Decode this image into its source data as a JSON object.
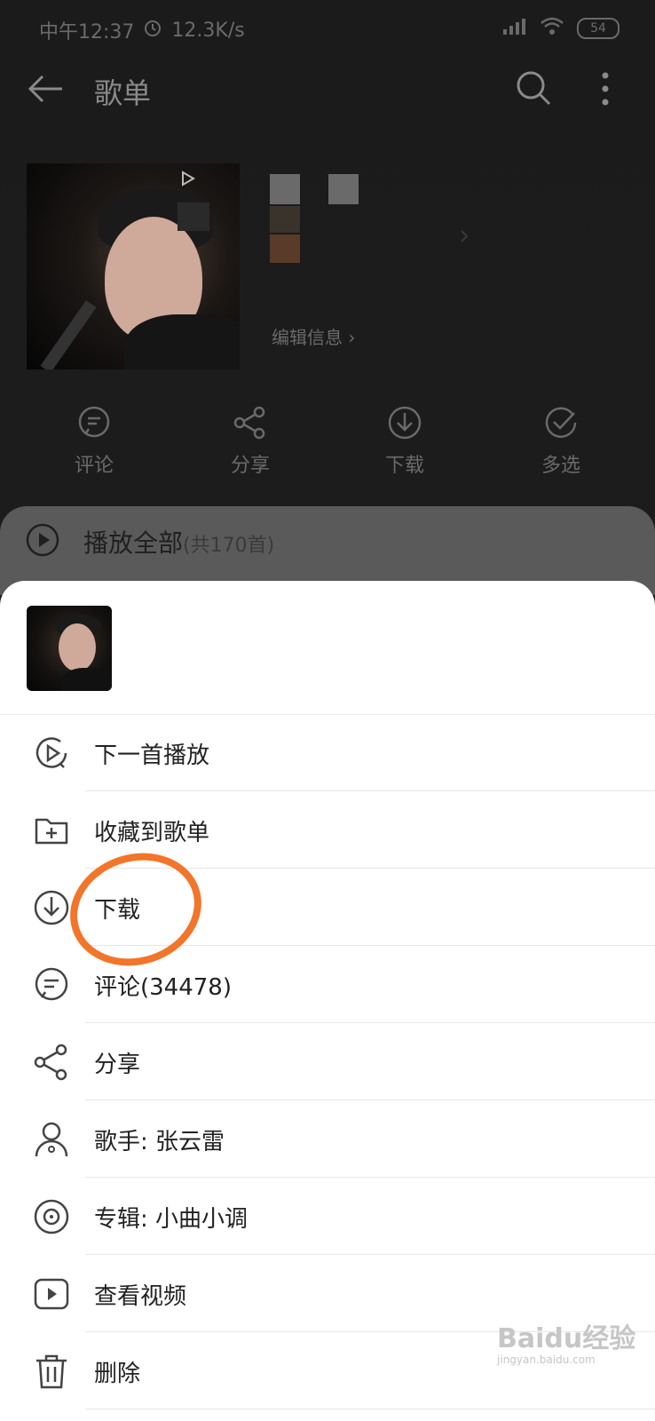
{
  "status_bar": {
    "time": "中午12:37",
    "speed": "12.3K/s",
    "battery": "54"
  },
  "header": {
    "title": "歌单"
  },
  "playlist": {
    "edit_info": "编辑信息 ›"
  },
  "actions": [
    {
      "label": "评论",
      "icon": "comment-icon"
    },
    {
      "label": "分享",
      "icon": "share-icon"
    },
    {
      "label": "下载",
      "icon": "download-icon"
    },
    {
      "label": "多选",
      "icon": "multiselect-icon"
    }
  ],
  "play_all": {
    "label": "播放全部",
    "count": "(共170首)"
  },
  "sheet": {
    "menu": [
      {
        "label": "下一首播放",
        "icon": "play-next-icon"
      },
      {
        "label": "收藏到歌单",
        "icon": "add-to-playlist-icon"
      },
      {
        "label": "下载",
        "icon": "download-icon"
      },
      {
        "label": "评论(34478)",
        "icon": "comment-icon"
      },
      {
        "label": "分享",
        "icon": "share-icon"
      },
      {
        "label": "歌手: 张云雷",
        "icon": "artist-icon"
      },
      {
        "label": "专辑: 小曲小调",
        "icon": "album-icon"
      },
      {
        "label": "查看视频",
        "icon": "video-icon"
      },
      {
        "label": "删除",
        "icon": "trash-icon"
      }
    ]
  },
  "watermark": {
    "text": "Baidu经验",
    "sub": "jingyan.baidu.com"
  },
  "colors": {
    "highlight_circle": "#f2752a"
  }
}
